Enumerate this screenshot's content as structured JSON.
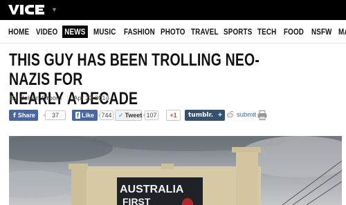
{
  "brand": {
    "logo_icon": "vice-logo-icon",
    "menu_icon": "chevron-down-icon"
  },
  "nav": {
    "items": [
      {
        "label": "HOME",
        "active": false
      },
      {
        "label": "VIDEO",
        "active": false
      },
      {
        "label": "NEWS",
        "active": true
      },
      {
        "label": "MUSIC",
        "active": false
      },
      {
        "label": "FASHION",
        "active": false
      },
      {
        "label": "PHOTO",
        "active": false
      },
      {
        "label": "TRAVEL",
        "active": false
      },
      {
        "label": "SPORTS",
        "active": false
      },
      {
        "label": "TECH",
        "active": false
      },
      {
        "label": "FOOD",
        "active": false
      },
      {
        "label": "NSFW",
        "active": false
      },
      {
        "label": "MA",
        "active": false
      }
    ]
  },
  "article": {
    "headline_line1": "THIS GUY HAS BEEN TROLLING NEO-NAZIS FOR",
    "headline_line2": "NEARLY A DECADE",
    "byline_prefix": "By",
    "author": "Nelson Groom",
    "date": "Apr 23 2014"
  },
  "social": {
    "facebook_share_label": "Share",
    "facebook_share_count": "37",
    "facebook_like_label": "Like",
    "facebook_like_count": "744",
    "tweet_label": "Tweet",
    "tweet_count": "107",
    "gplus_label": "+1",
    "tumblr_label": "tumblr.",
    "tumblr_plus": "+",
    "submit_label": "submit"
  },
  "photo": {
    "sign_text": "AUSTRALIA",
    "sign_text_partial": "FIRST"
  },
  "colors": {
    "topbar": "#000000",
    "facebook": "#4a66a0",
    "tumblr": "#34526f",
    "link": "#336699"
  }
}
